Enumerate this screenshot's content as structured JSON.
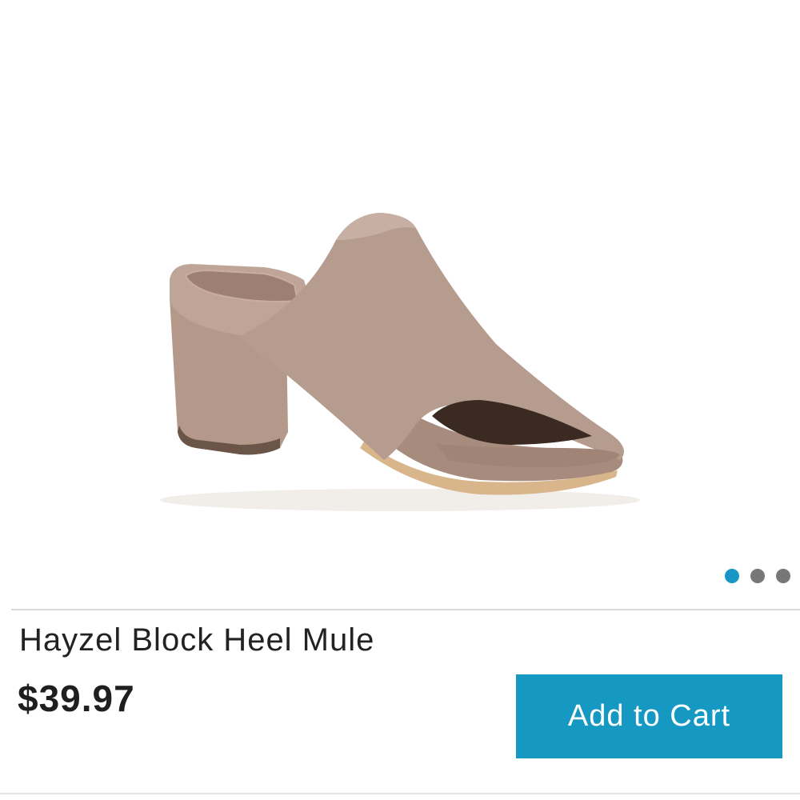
{
  "product": {
    "image_icon": "block-heel-mule-shoe",
    "title": "Hayzel Block Heel Mule",
    "price": "$39.97"
  },
  "carousel": {
    "dot_count": 3,
    "active_index": 0,
    "active_color": "#1a96c6",
    "inactive_color": "#777777"
  },
  "actions": {
    "add_to_cart_label": "Add to Cart",
    "button_color": "#1599c3"
  }
}
